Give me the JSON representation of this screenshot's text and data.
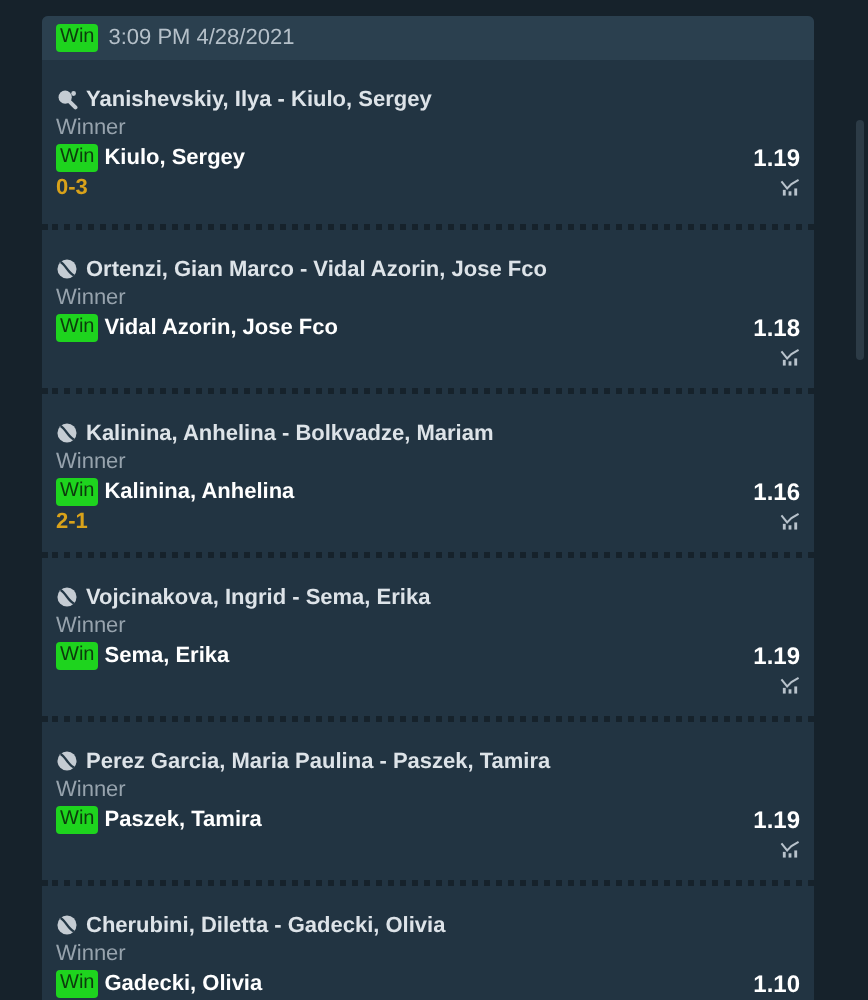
{
  "header": {
    "result": "Win",
    "datetime": "3:09 PM 4/28/2021"
  },
  "bets": [
    {
      "kind": "paddle",
      "event": "Yanishevskiy, Ilya - Kiulo, Sergey",
      "market": "Winner",
      "result": "Win",
      "pick": "Kiulo, Sergey",
      "odds": "1.19",
      "score": "0-3",
      "stats_button": true
    },
    {
      "kind": "ball",
      "event": "Ortenzi, Gian Marco - Vidal Azorin, Jose Fco",
      "market": "Winner",
      "result": "Win",
      "pick": "Vidal Azorin, Jose Fco",
      "odds": "1.18",
      "stats_button": true
    },
    {
      "kind": "ball",
      "event": "Kalinina, Anhelina - Bolkvadze, Mariam",
      "market": "Winner",
      "result": "Win",
      "pick": "Kalinina, Anhelina",
      "odds": "1.16",
      "score": "2-1",
      "stats_button": true
    },
    {
      "kind": "ball",
      "event": "Vojcinakova, Ingrid - Sema, Erika",
      "market": "Winner",
      "result": "Win",
      "pick": "Sema, Erika",
      "odds": "1.19",
      "stats_button": true
    },
    {
      "kind": "ball",
      "event": "Perez Garcia, Maria Paulina - Paszek, Tamira",
      "market": "Winner",
      "result": "Win",
      "pick": "Paszek, Tamira",
      "odds": "1.19",
      "stats_button": true
    },
    {
      "kind": "ball",
      "event": "Cherubini, Diletta - Gadecki, Olivia",
      "market": "Winner",
      "result": "Win",
      "pick": "Gadecki, Olivia",
      "odds": "1.10"
    }
  ]
}
